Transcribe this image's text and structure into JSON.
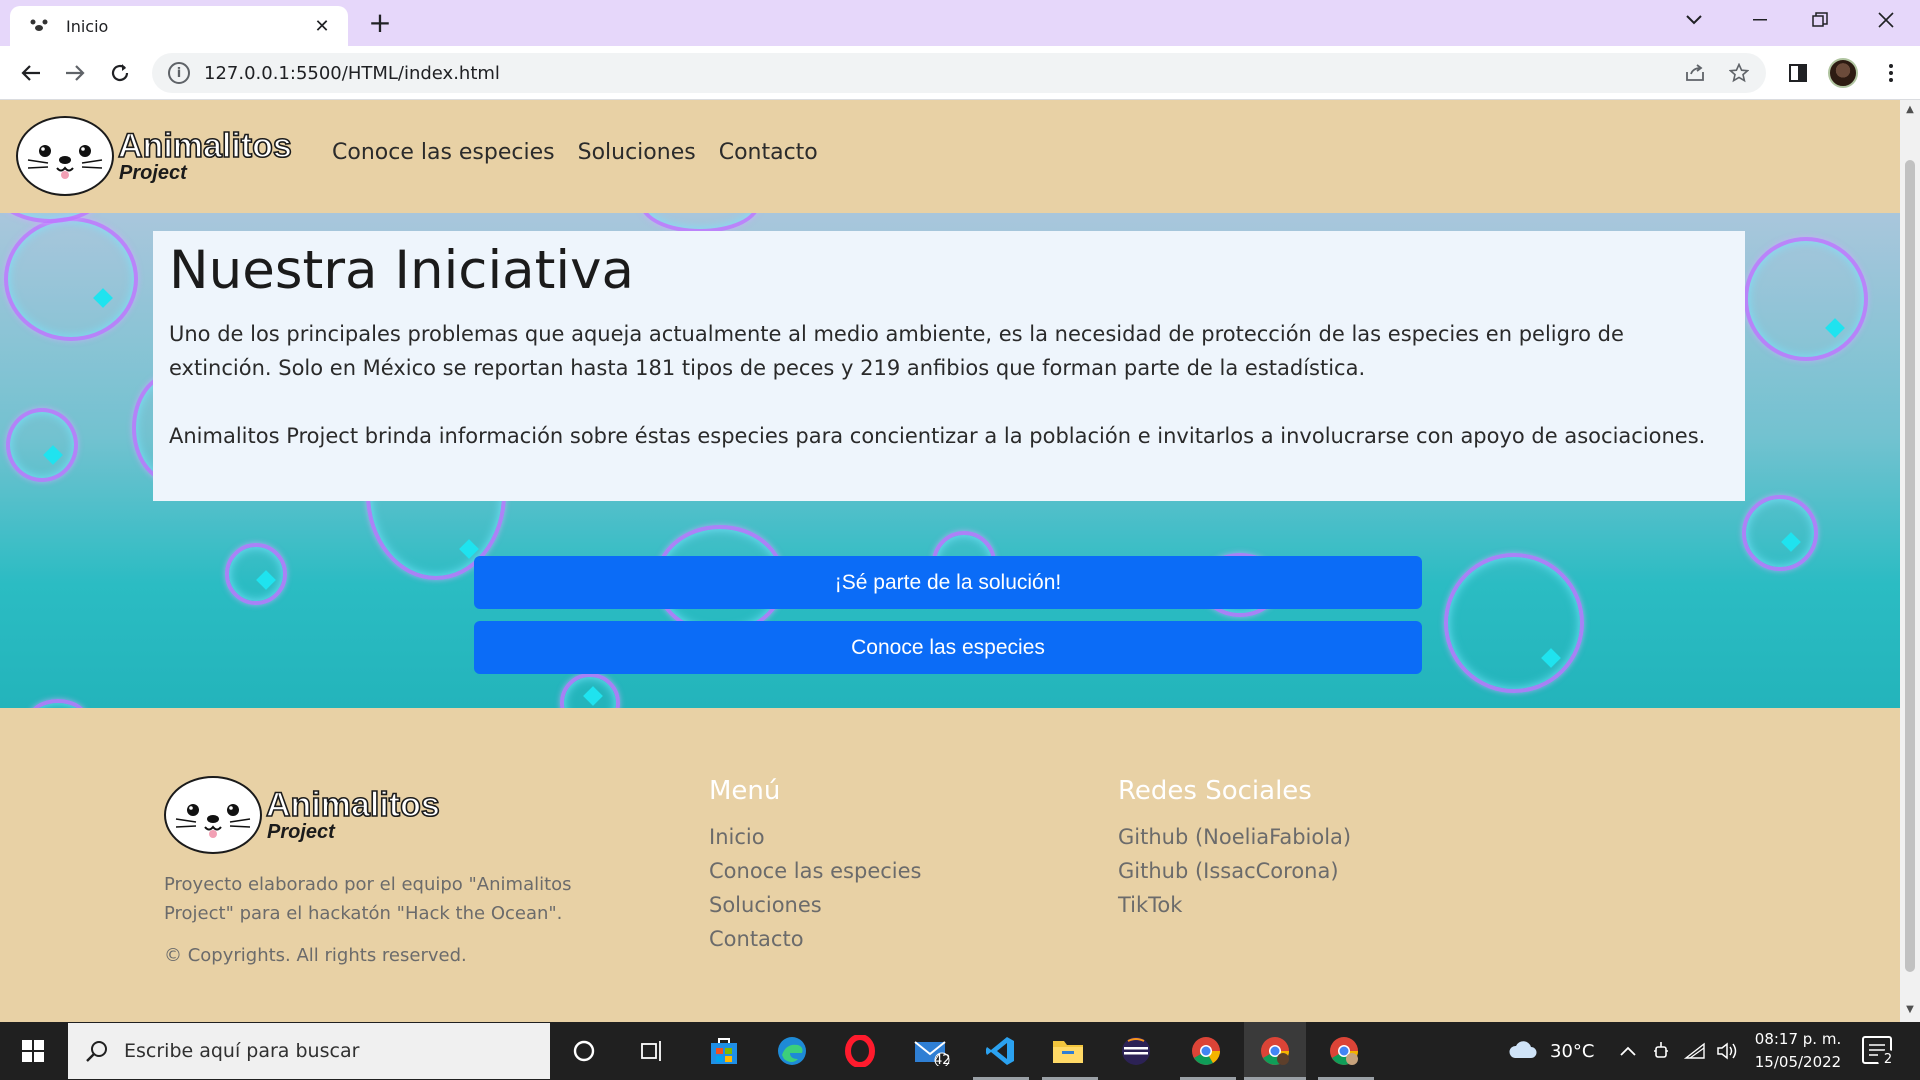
{
  "browser": {
    "tab_title": "Inicio",
    "new_tab_symbol": "+",
    "close_tab_symbol": "✕",
    "url": "127.0.0.1:5500/HTML/index.html"
  },
  "header": {
    "logo_name": "Animalitos",
    "logo_sub": "Project",
    "nav": [
      "Conoce las especies",
      "Soluciones",
      "Contacto"
    ]
  },
  "hero": {
    "title": "Nuestra Iniciativa",
    "paragraph1": "Uno de los principales problemas que aqueja actualmente al medio ambiente, es la necesidad de protección de las especies en peligro de extinción. Solo en México se reportan hasta 181 tipos de peces y 219 anfibios que forman parte de la estadística.",
    "paragraph2": "Animalitos Project brinda información sobre éstas especies para concientizar a la población e invitarlos a involucrarse con apoyo de asociaciones.",
    "button_primary": "¡Sé parte de la solución!",
    "button_secondary": "Conoce las especies"
  },
  "footer": {
    "logo_name": "Animalitos",
    "logo_sub": "Project",
    "description": "Proyecto elaborado por el equipo \"Animalitos Project\" para el hackatón \"Hack the Ocean\".",
    "copyright": "© Copyrights. All rights reserved.",
    "menu_title": "Menú",
    "menu_items": [
      "Inicio",
      "Conoce las especies",
      "Soluciones",
      "Contacto"
    ],
    "social_title": "Redes Sociales",
    "social_items": [
      "Github (NoeliaFabiola)",
      "Github (IssacCorona)",
      "TikTok"
    ]
  },
  "taskbar": {
    "search_placeholder": "Escribe aquí para buscar",
    "mail_badge": "42",
    "weather": "30°C",
    "time": "08:17 p. m.",
    "date": "15/05/2022",
    "notification_count": "2"
  },
  "colors": {
    "page_bg": "#e8d1a5",
    "button_blue": "#0b6cf7",
    "card_bg": "#eef5fc",
    "chrome_tabstrip": "#e6d7fa"
  }
}
